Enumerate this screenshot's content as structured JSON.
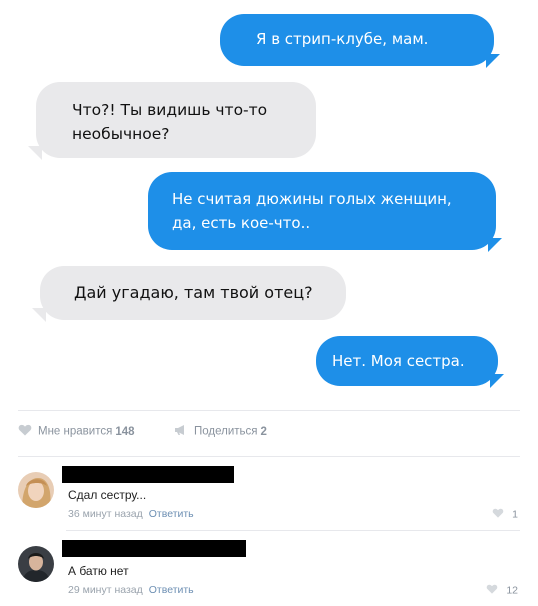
{
  "messages": [
    {
      "side": "out",
      "text": "Я в стрип-клубе, мам."
    },
    {
      "side": "in",
      "lines": [
        "Что?! Ты видишь что-то",
        "необычное?"
      ]
    },
    {
      "side": "out",
      "lines": [
        "Не считая дюжины голых женщин,",
        "да, есть кое-что.."
      ]
    },
    {
      "side": "in",
      "text": "Дай угадаю, там твой отец?"
    },
    {
      "side": "out",
      "text": "Нет. Моя сестра."
    }
  ],
  "actions": {
    "like_label": "Мне нравится",
    "like_count": "148",
    "share_label": "Поделиться",
    "share_count": "2"
  },
  "comments": [
    {
      "text": "Сдал сестру...",
      "time": "36 минут назад",
      "reply_label": "Ответить",
      "likes": "1"
    },
    {
      "text": "А батю нет",
      "time": "29 минут назад",
      "reply_label": "Ответить",
      "likes": "12"
    }
  ],
  "colors": {
    "outgoing_bubble": "#1e8fe8",
    "incoming_bubble": "#e9e9eb",
    "meta_text": "#9aa3ad",
    "link": "#6d8fb3"
  },
  "icons": {
    "like": "heart-icon",
    "share": "megaphone-icon",
    "comment_like": "heart-icon"
  }
}
